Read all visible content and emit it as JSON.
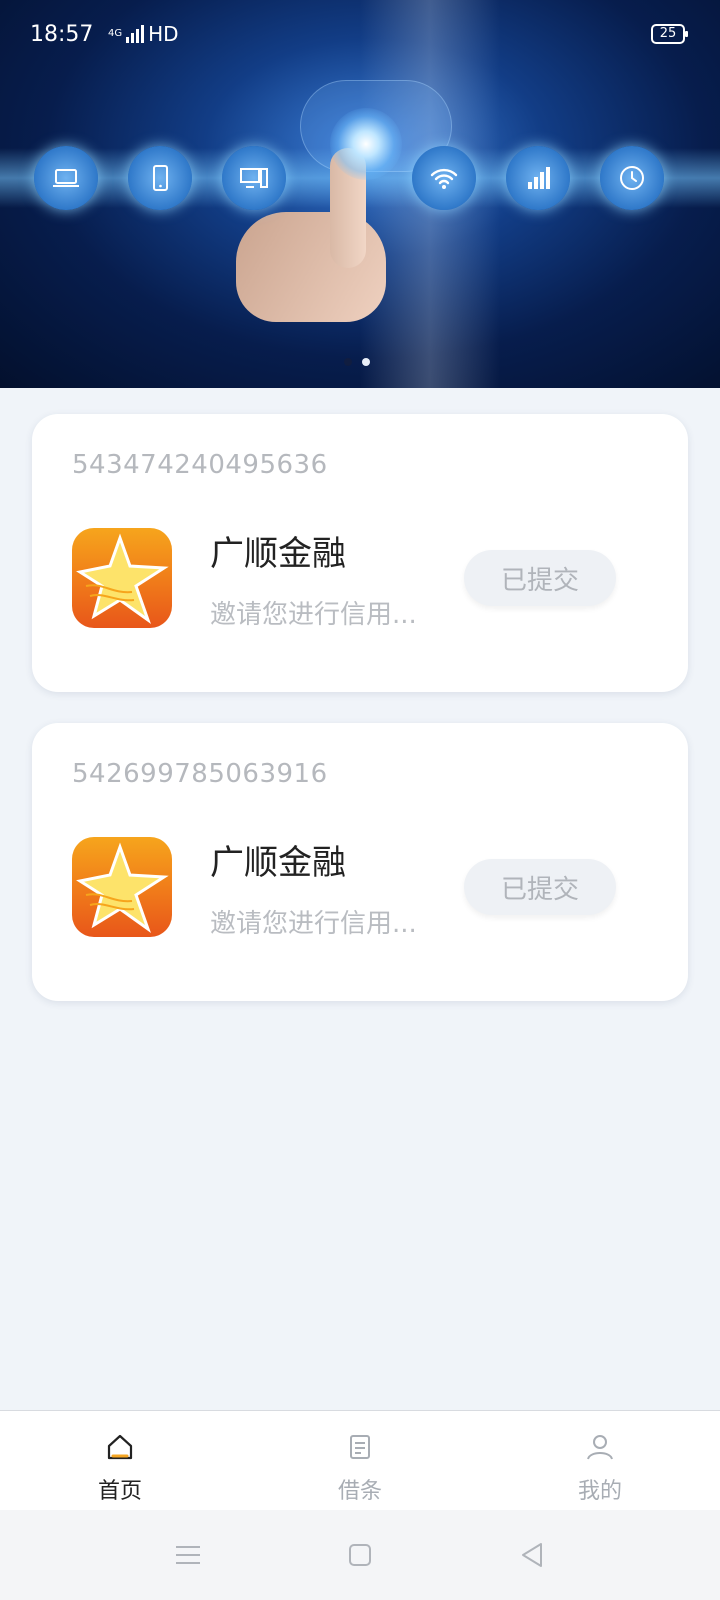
{
  "status_bar": {
    "time": "18:57",
    "network_type": "4G",
    "hd_label": "HD",
    "battery": "25"
  },
  "banner": {
    "slides": 2,
    "active_slide": 2
  },
  "cards": [
    {
      "id": "543474240495636",
      "app_name": "广顺金融",
      "description": "邀请您进行信用...",
      "status": "已提交"
    },
    {
      "id": "542699785063916",
      "app_name": "广顺金融",
      "description": "邀请您进行信用...",
      "status": "已提交"
    }
  ],
  "tabs": [
    {
      "label": "首页",
      "icon": "home-icon",
      "active": true
    },
    {
      "label": "借条",
      "icon": "document-icon",
      "active": false
    },
    {
      "label": "我的",
      "icon": "user-icon",
      "active": false
    }
  ],
  "colors": {
    "accent": "#f5a623",
    "background": "#f0f4f9",
    "card": "#ffffff"
  }
}
